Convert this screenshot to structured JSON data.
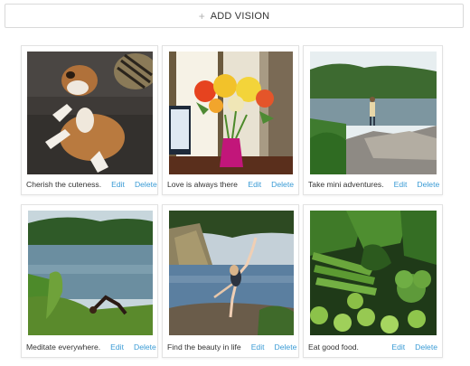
{
  "add_button": {
    "icon": "plus-icon",
    "label": "ADD VISION"
  },
  "colors": {
    "link": "#3a9bd5",
    "text": "#333333",
    "border": "#e2e2e2"
  },
  "visions": [
    {
      "caption": "Cherish the cuteness.",
      "edit": "Edit",
      "delete": "Delete",
      "image": "boxer-dog-on-couch"
    },
    {
      "caption": "Love is always there",
      "edit": "Edit",
      "delete": "Delete",
      "image": "flowers-in-vase"
    },
    {
      "caption": "Take mini adventures.",
      "edit": "Edit",
      "delete": "Delete",
      "image": "person-on-river-rocks"
    },
    {
      "caption": "Meditate everywhere.",
      "edit": "Edit",
      "delete": "Delete",
      "image": "yoga-by-lake"
    },
    {
      "caption": "Find the beauty in life",
      "edit": "Edit",
      "delete": "Delete",
      "image": "yoga-pose-at-water"
    },
    {
      "caption": "Eat good food.",
      "edit": "Edit",
      "delete": "Delete",
      "image": "fresh-vegetables"
    }
  ]
}
